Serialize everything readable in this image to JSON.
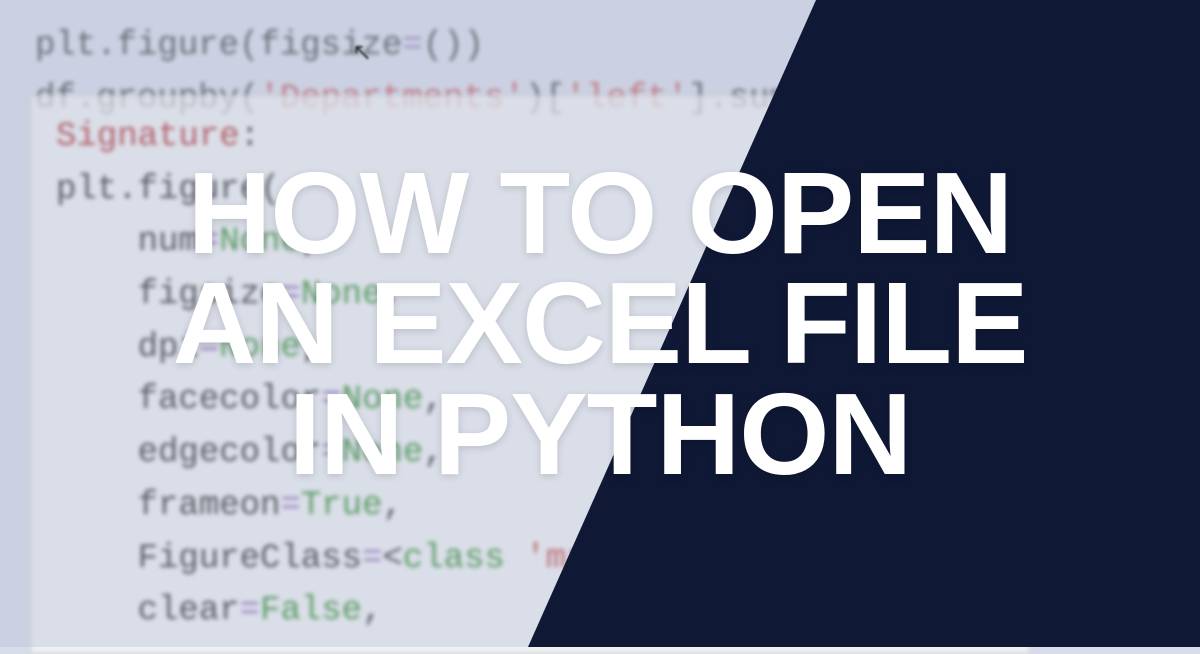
{
  "code": {
    "line1_obj": "plt",
    "line1_dot1": ".",
    "line1_attr": "figure",
    "line1_paren1": "(",
    "line1_param": "figsize",
    "line1_eq": "=",
    "line1_paren2": "()",
    "line1_paren3": ")",
    "line2_obj": "df",
    "line2_dot1": ".",
    "line2_attr": "groupby",
    "line2_paren1": "(",
    "line2_str1": "'Departments'",
    "line2_paren2": ")[",
    "line2_str2": "'left'",
    "line2_paren3": "]",
    "line2_dot2": ".",
    "line2_attr2": "sum",
    "line2_paren4": "()"
  },
  "tooltip": {
    "sig_label": "Signature",
    "sig_colon": ":",
    "plt_obj": "plt",
    "plt_dot": ".",
    "plt_attr": "figure",
    "plt_paren": "(",
    "p1_name": "num",
    "p1_eq": "=",
    "p1_val": "None",
    "p1_comma": ",",
    "p2_name": "figsize",
    "p2_eq": "=",
    "p2_val": "None",
    "p2_comma": ",",
    "p3_name": "dpi",
    "p3_eq": "=",
    "p3_val": "None",
    "p3_comma": ",",
    "p4_name": "facecolor",
    "p4_eq": "=",
    "p4_val": "None",
    "p4_comma": ",",
    "p5_name": "edgecolor",
    "p5_eq": "=",
    "p5_val": "None",
    "p5_comma": ",",
    "p6_name": "frameon",
    "p6_eq": "=",
    "p6_val": "True",
    "p6_comma": ",",
    "p7_name": "FigureClass",
    "p7_eq": "=",
    "p7_lt": "<",
    "p7_class": "class",
    "p7_sp": " ",
    "p7_str": "'matplotlib",
    "p8_name": "clear",
    "p8_eq": "=",
    "p8_val": "False",
    "p8_comma": ","
  },
  "title": {
    "line1": "HOW TO OPEN",
    "line2": "AN EXCEL FILE",
    "line3": "IN PYTHON"
  }
}
